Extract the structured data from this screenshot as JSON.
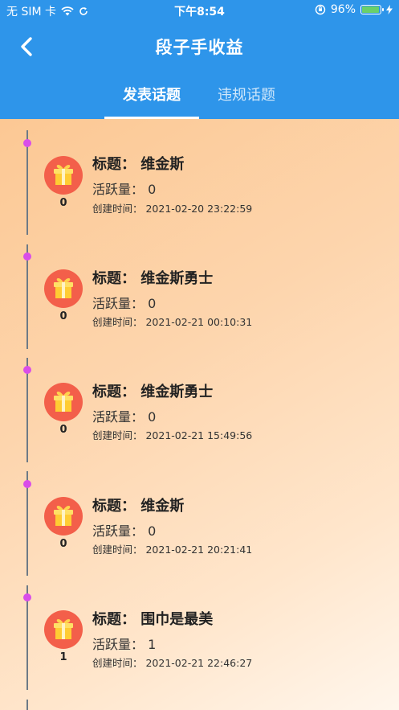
{
  "status_bar": {
    "carrier": "无 SIM 卡",
    "time": "下午8:54",
    "battery_percent": "96%",
    "battery_level": 0.96
  },
  "nav": {
    "title": "段子手收益"
  },
  "tabs": [
    {
      "label": "发表话题",
      "active": true
    },
    {
      "label": "违规话题",
      "active": false
    }
  ],
  "items": [
    {
      "title": "标题：  维金斯",
      "activity": "活跃量：  0",
      "time": "创建时间：  2021-02-20 23:22:59",
      "count": "0"
    },
    {
      "title": "标题：  维金斯勇士",
      "activity": "活跃量：  0",
      "time": "创建时间：  2021-02-21 00:10:31",
      "count": "0"
    },
    {
      "title": "标题：  维金斯勇士",
      "activity": "活跃量：  0",
      "time": "创建时间：  2021-02-21 15:49:56",
      "count": "0"
    },
    {
      "title": "标题：  维金斯",
      "activity": "活跃量：  0",
      "time": "创建时间：  2021-02-21 20:21:41",
      "count": "0"
    },
    {
      "title": "标题：  围巾是最美",
      "activity": "活跃量：  1",
      "time": "创建时间：  2021-02-21 22:46:27",
      "count": "1"
    }
  ]
}
